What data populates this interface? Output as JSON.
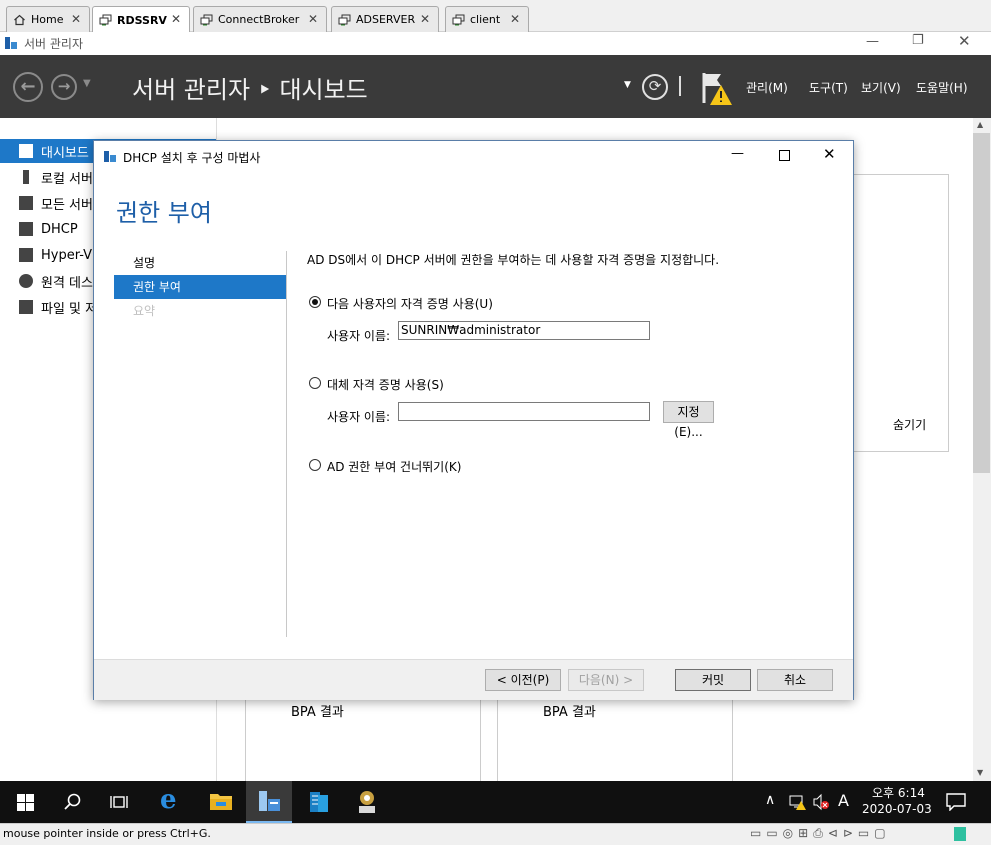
{
  "host_tabs": [
    {
      "label": "Home",
      "icon": "home-icon",
      "active": false
    },
    {
      "label": "RDSSRV",
      "icon": "remote-desktop-icon",
      "active": true
    },
    {
      "label": "ConnectBroker",
      "icon": "remote-desktop-icon",
      "active": false
    },
    {
      "label": "ADSERVER",
      "icon": "remote-desktop-icon",
      "active": false
    },
    {
      "label": "client",
      "icon": "remote-desktop-icon",
      "active": false
    }
  ],
  "server_manager": {
    "window_title": "서버 관리자",
    "header_title": "서버 관리자 ‣ 대시보드",
    "menu": [
      "관리(M)",
      "도구(T)",
      "보기(V)",
      "도움말(H)"
    ],
    "sidebar": [
      {
        "label": "대시보드",
        "icon": "dashboard-icon",
        "selected": true
      },
      {
        "label": "로컬 서버",
        "icon": "local-server-icon",
        "selected": false
      },
      {
        "label": "모든 서버",
        "icon": "all-servers-icon",
        "selected": false
      },
      {
        "label": "DHCP",
        "icon": "dhcp-icon",
        "selected": false
      },
      {
        "label": "Hyper-V",
        "icon": "hyper-v-icon",
        "selected": false
      },
      {
        "label": "원격 데스크톱",
        "icon": "remote-desktop-services-icon",
        "selected": false
      },
      {
        "label": "파일 및 저장소 서비스",
        "icon": "file-storage-icon",
        "selected": false
      }
    ],
    "hide_label": "숨기기",
    "tiles": [
      {
        "label": "BPA 결과"
      },
      {
        "label": "BPA 결과"
      }
    ]
  },
  "dialog": {
    "title": "DHCP 설치 후 구성 마법사",
    "heading": "권한 부여",
    "nav": [
      {
        "label": "설명",
        "state": "normal"
      },
      {
        "label": "권한 부여",
        "state": "selected"
      },
      {
        "label": "요약",
        "state": "disabled"
      }
    ],
    "description": "AD DS에서 이 DHCP 서버에 권한을 부여하는 데 사용할 자격 증명을 지정합니다.",
    "options": [
      {
        "label": "다음 사용자의 자격 증명 사용(U)",
        "checked": true
      },
      {
        "label": "대체 자격 증명 사용(S)",
        "checked": false
      },
      {
        "label": "AD 권한 부여 건너뛰기(K)",
        "checked": false
      }
    ],
    "username_label": "사용자 이름:",
    "username_value": "SUNRIN₩administrator",
    "alt_username_label": "사용자 이름:",
    "alt_username_value": "",
    "specify_button": "지정(E)...",
    "buttons": {
      "prev": "< 이전(P)",
      "next": "다음(N) >",
      "commit": "커밋",
      "cancel": "취소"
    }
  },
  "taskbar": {
    "time": "오후 6:14",
    "date": "2020-07-03",
    "ime": "A"
  },
  "status_text": "mouse pointer inside or press Ctrl+G."
}
